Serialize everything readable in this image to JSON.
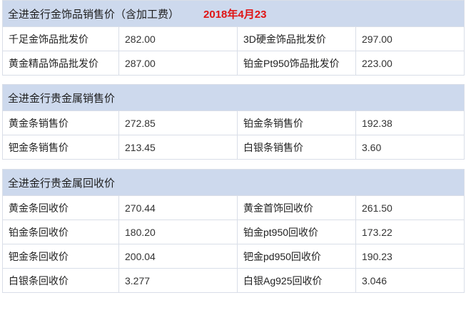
{
  "section1": {
    "title": "全进金行金饰品销售价（含加工费）",
    "date": "2018年4月23",
    "rows": [
      {
        "label1": "千足金饰品批发价",
        "value1": "282.00",
        "label2": "3D硬金饰品批发价",
        "value2": "297.00"
      },
      {
        "label1": "黄金精品饰品批发价",
        "value1": "287.00",
        "label2": "铂金Pt950饰品批发价",
        "value2": "223.00"
      }
    ]
  },
  "section2": {
    "title": "全进金行贵金属销售价",
    "rows": [
      {
        "label1": "黄金条销售价",
        "value1": "272.85",
        "label2": "铂金条销售价",
        "value2": "192.38"
      },
      {
        "label1": "钯金条销售价",
        "value1": "213.45",
        "label2": "白银条销售价",
        "value2": "3.60"
      }
    ]
  },
  "section3": {
    "title": "全进金行贵金属回收价",
    "rows": [
      {
        "label1": "黄金条回收价",
        "value1": "270.44",
        "label2": "黄金首饰回收价",
        "value2": "261.50"
      },
      {
        "label1": "铂金条回收价",
        "value1": "180.20",
        "label2": "铂金pt950回收价",
        "value2": "173.22"
      },
      {
        "label1": "钯金条回收价",
        "value1": "200.04",
        "label2": "钯金pd950回收价",
        "value2": "190.23"
      },
      {
        "label1": "白银条回收价",
        "value1": "3.277",
        "label2": "白银Ag925回收价",
        "value2": "3.046"
      }
    ]
  },
  "colors": {
    "header_background": "#cdd9ed",
    "border": "#d9dee8",
    "date_text": "#e01414"
  }
}
